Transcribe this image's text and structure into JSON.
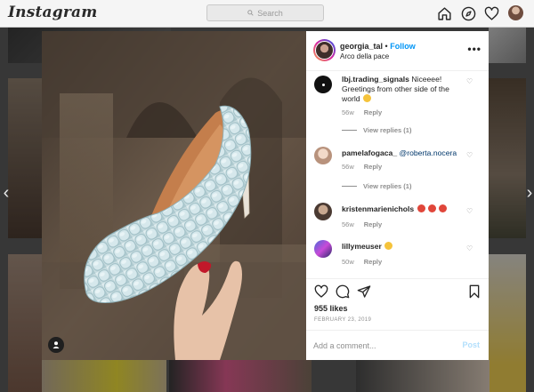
{
  "topbar": {
    "logo": "Instagram",
    "search_placeholder": "Search",
    "icons": [
      "home-icon",
      "explore-compass-icon",
      "activity-heart-icon",
      "profile-avatar"
    ]
  },
  "post": {
    "header": {
      "username": "georgia_tal",
      "separator": "•",
      "follow_label": "Follow",
      "location": "Arco della pace",
      "more_label": "•••"
    },
    "comments": [
      {
        "username": "lbj.trading_signals",
        "text": "Niceeee! Greetings from other side of the world",
        "emoji": "grinning-face-emoji",
        "age": "56w",
        "reply_label": "Reply",
        "view_replies": "View replies (1)"
      },
      {
        "username": "pamelafogaca_",
        "mention": "@roberta.nocera",
        "age": "56w",
        "reply_label": "Reply",
        "view_replies": "View replies (1)"
      },
      {
        "username": "kristenmarienichols",
        "emoji": "heart-eyes-emoji x3",
        "age": "56w",
        "reply_label": "Reply"
      },
      {
        "username": "lillymeuser",
        "emoji": "grinning-face-emoji",
        "age": "50w",
        "reply_label": "Reply"
      }
    ],
    "likes": "955 likes",
    "date": "FEBRUARY 23, 2019",
    "add_comment_placeholder": "Add a comment...",
    "post_label": "Post"
  },
  "colors": {
    "link_blue": "#0095f6",
    "post_disabled": "#b2dffc",
    "muted": "#8e8e8e",
    "text": "#262626"
  }
}
